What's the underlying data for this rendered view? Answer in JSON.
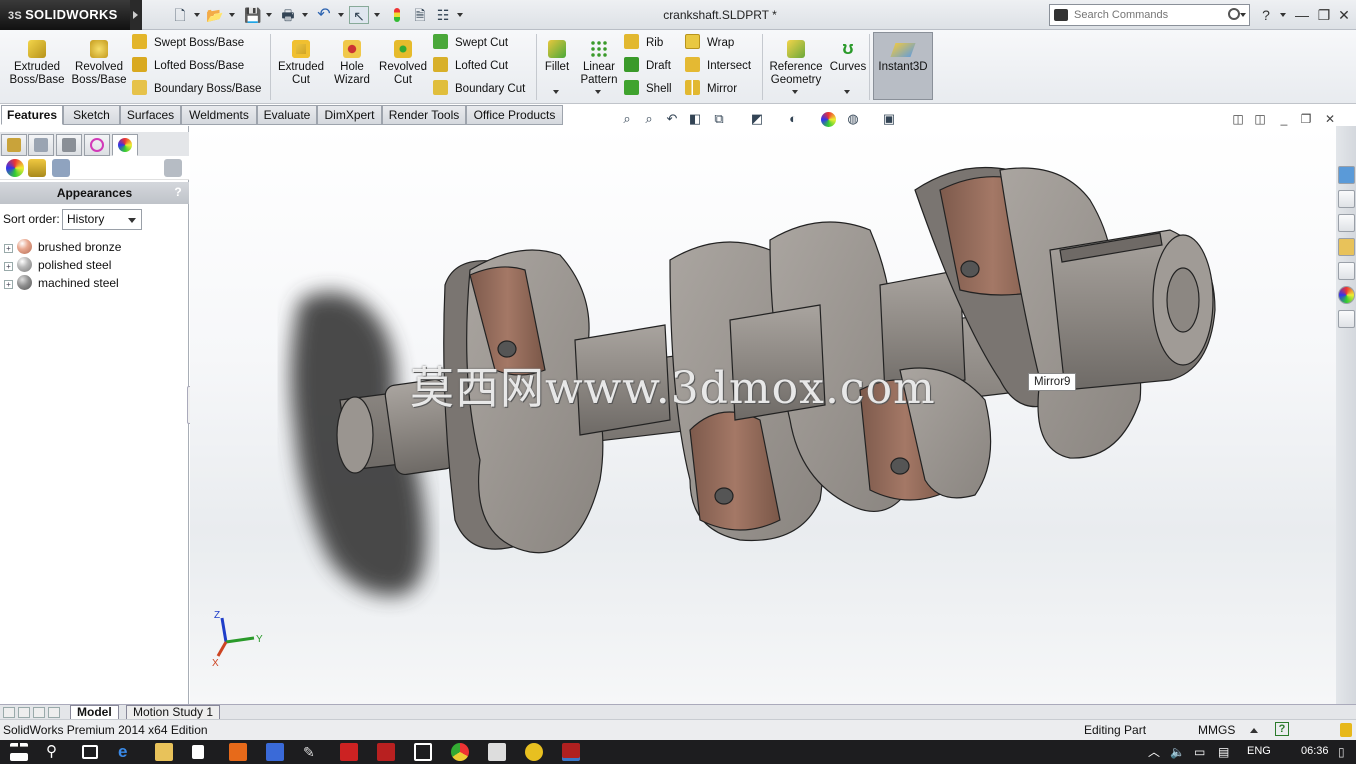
{
  "titlebar": {
    "brand": "SOLIDWORKS",
    "brand_prefix": "3S",
    "document_title": "crankshaft.SLDPRT *",
    "search_placeholder": "Search Commands",
    "help": "?",
    "quick_access": [
      "new-doc-icon",
      "open-folder-icon",
      "save-icon",
      "print-icon",
      "undo-icon",
      "select-arrow-icon",
      "rebuild-icon",
      "file-properties-icon",
      "options-icon"
    ]
  },
  "ribbon": {
    "extruded_boss": "Extruded\nBoss/Base",
    "revolved_boss": "Revolved\nBoss/Base",
    "swept_boss": "Swept Boss/Base",
    "lofted_boss": "Lofted Boss/Base",
    "boundary_boss": "Boundary Boss/Base",
    "extruded_cut": "Extruded\nCut",
    "hole_wizard": "Hole\nWizard",
    "revolved_cut": "Revolved\nCut",
    "swept_cut": "Swept Cut",
    "lofted_cut": "Lofted Cut",
    "boundary_cut": "Boundary Cut",
    "fillet": "Fillet",
    "linear_pattern": "Linear\nPattern",
    "rib": "Rib",
    "draft": "Draft",
    "shell": "Shell",
    "wrap": "Wrap",
    "intersect": "Intersect",
    "mirror": "Mirror",
    "reference_geometry": "Reference\nGeometry",
    "curves": "Curves",
    "instant3d": "Instant3D"
  },
  "command_tabs": [
    "Features",
    "Sketch",
    "Surfaces",
    "Weldments",
    "Evaluate",
    "DimXpert",
    "Render Tools",
    "Office Products"
  ],
  "panel": {
    "title": "Appearances",
    "help": "?",
    "sort_label": "Sort order:",
    "sort_value": "History",
    "items": [
      {
        "label": "brushed bronze",
        "color": "#e9a991"
      },
      {
        "label": "polished steel",
        "color": "#b9b9b9"
      },
      {
        "label": "machined steel",
        "color": "#8f8f8f"
      }
    ]
  },
  "viewport": {
    "watermark": "莫西网www.3dmox.com",
    "tooltip": "Mirror9",
    "triad": {
      "x": "X",
      "y": "Y",
      "z": "Z"
    }
  },
  "bottom_tabs": [
    "Model",
    "Motion Study 1"
  ],
  "status": {
    "left": "SolidWorks Premium 2014 x64 Edition",
    "mode": "Editing Part",
    "units": "MMGS",
    "help": "?"
  },
  "taskbar": {
    "lang": "ENG",
    "time": "06:36"
  },
  "colors": {
    "bronze": "#a47866",
    "steel": "#8d8883",
    "steel_light": "#a8a39e",
    "steel_dark": "#6e6a66",
    "accent": "#3a78c8"
  }
}
